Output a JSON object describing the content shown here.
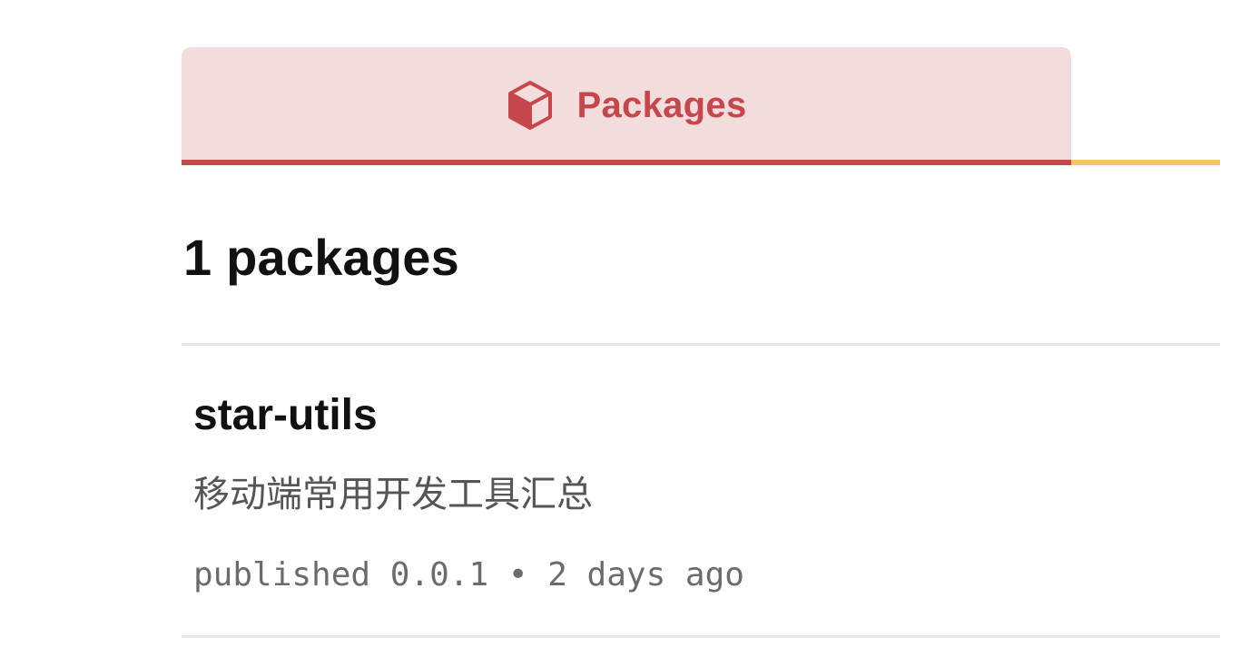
{
  "tabs": {
    "active": {
      "icon": "cube-icon",
      "label": "Packages"
    }
  },
  "colors": {
    "accent": "#c6474b",
    "tab_background": "#f3dcdc",
    "secondary_underline": "#f5c75e",
    "divider": "#e6e6e6"
  },
  "results": {
    "count_heading": "1 packages"
  },
  "packages": [
    {
      "name": "star-utils",
      "description": "移动端常用开发工具汇总",
      "published_label": "published",
      "version": "0.0.1",
      "separator": "•",
      "published_ago": "2 days ago"
    }
  ]
}
